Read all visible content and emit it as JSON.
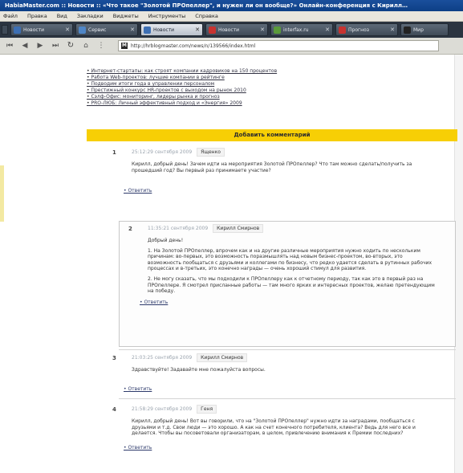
{
  "window": {
    "title": "HabiaMaster.com :: Новости :: «Что такое \"Золотой ПРОпеллер\", и нужен ли он вообще?» Онлайн-конференция с Кирилл…"
  },
  "menu": {
    "items": [
      "Файл",
      "Правка",
      "Вид",
      "Закладки",
      "Виджеты",
      "Инструменты",
      "Справка"
    ]
  },
  "tabs": [
    {
      "label": "Новости",
      "color": "#3d6fb3",
      "active": false
    },
    {
      "label": "Сервис",
      "color": "#4f86c6",
      "active": false
    },
    {
      "label": "Новости",
      "color": "#3d6fb3",
      "active": true
    },
    {
      "label": "Новости",
      "color": "#c8322f",
      "active": false
    },
    {
      "label": "interfax.ru",
      "color": "#5a9a3a",
      "active": false
    },
    {
      "label": "Прогноз",
      "color": "#c8322f",
      "active": false
    },
    {
      "label": "Мир",
      "color": "#222222",
      "active": false
    }
  ],
  "navigation": {
    "url": "http://hrblogmaster.com/news/n/139566/index.html",
    "site_icon": "M"
  },
  "links": [
    "Интернет-стартапы: как строят компании кадровиков на 150 процентов",
    "Работа Web-проектов: лучшие компании в рейтинге",
    "Подводим итоги года в управлении персоналом",
    "Престижный конкурс HR-проектов с выходом на рынок 2010",
    "Сэлф-Офис: мониторинг, лидеры рынка и прогноз",
    "PRO-ЛЮБ: Личный эффективный подход и «Энергия» 2009"
  ],
  "add_comment_label": "Добавить комментарий",
  "comments": [
    {
      "number": "1",
      "date": "25:12:29 сентября 2009",
      "author": "Ященко",
      "paragraphs": [
        "Кирилл, добрый день! Зачем идти на мероприятия Золотой ПРОпеллер? Что там можно сделать/получить за прошедший год? Вы первый раз принимаете участие?"
      ],
      "reply": "Ответить"
    },
    {
      "number": "2",
      "date": "11:35:21 сентября 2009",
      "author": "Кирилл Смирнов",
      "paragraphs": [
        "Добрый день!",
        "1. На Золотой ПРОпеллер, впрочем как и на другие различные мероприятия нужно ходить по нескольким причинам: во-первых, это возможность поразмышлять над новым бизнес-проектом, во-вторых, это возможность пообщаться с друзьями и коллегами по бизнесу, что редко удается сделать в рутинных рабочих процессах и в-третьих, это конечно награды — очень хороший стимул для развития.",
        "2. Не могу сказать, что мы подходили к ПРОпеллеру как к отчетному периоду, так как это в первый раз на ПРОпеллере. Я смотрел присланные работы — там много ярких и интересных проектов, желаю претендующим на победу."
      ],
      "reply": "Ответить"
    },
    {
      "number": "3",
      "date": "21:03:25 сентября 2009",
      "author": "Кирилл Смирнов",
      "paragraphs": [
        "Здравствуйте! Задавайте мне пожалуйста вопросы."
      ],
      "reply": "Ответить"
    },
    {
      "number": "4",
      "date": "21:58:29 сентября 2009",
      "author": "Геня",
      "paragraphs": [
        "Кирилл, добрый день! Вот вы говорили, что на \"Золотой ПРОпеллер\" нужно идти за наградами, пообщаться с друзьями и т.д. Свои люди — это хорошо. А как на счет конечного потребителя, клиента? Ведь для него все и делается. Чтобы вы посоветовали организаторам, в целом, привлечению внимания к Премии последних?"
      ],
      "reply": "Ответить"
    }
  ]
}
